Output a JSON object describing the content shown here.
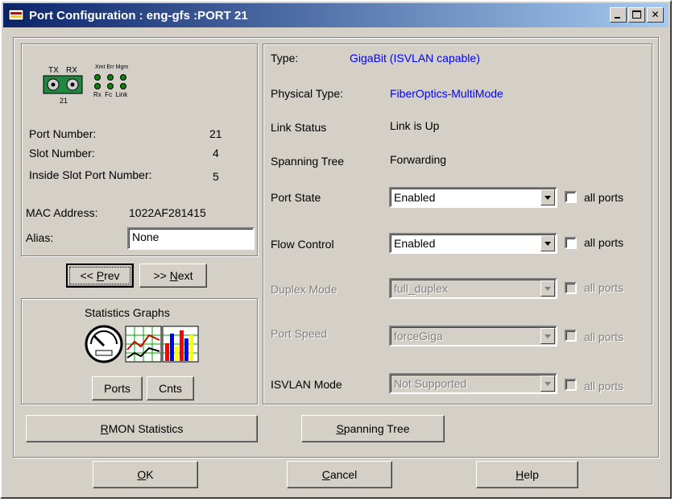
{
  "window": {
    "title": "Port Configuration : eng-gfs :PORT 21"
  },
  "port_icon": {
    "tx": "TX",
    "rx": "RX",
    "top_labels": "Xmt Err Mgm",
    "bottom_labels": "Rx  Fc  Link",
    "number": "21"
  },
  "port_info": {
    "port_number_label": "Port Number:",
    "port_number": "21",
    "slot_number_label": "Slot Number:",
    "slot_number": "4",
    "inside_slot_label": "Inside Slot Port Number:",
    "inside_slot": "5",
    "mac_label": "MAC Address:",
    "mac": "1022AF281415",
    "alias_label": "Alias:",
    "alias_value": "None"
  },
  "nav": {
    "prev_pre": "<< ",
    "prev_key": "P",
    "prev_rest": "rev",
    "next_pre": ">> ",
    "next_key": "N",
    "next_rest": "ext"
  },
  "stats": {
    "title": "Statistics Graphs",
    "ports_label": "Ports",
    "cnts_label": "Cnts"
  },
  "rmon": {
    "key": "R",
    "rest": "MON Statistics"
  },
  "spanning_btn": {
    "key": "S",
    "rest": "panning Tree"
  },
  "details": {
    "type_label": "Type:",
    "type_value": "GigaBit (ISVLAN capable)",
    "phys_label": "Physical Type:",
    "phys_value": "FiberOptics-MultiMode",
    "link_label": "Link Status",
    "link_value": "Link is Up",
    "stp_label": "Spanning Tree",
    "stp_value": "Forwarding",
    "port_state_label": "Port State",
    "port_state_value": "Enabled",
    "flow_label": "Flow Control",
    "flow_value": "Enabled",
    "duplex_label": "Duplex Mode",
    "duplex_value": "full_duplex",
    "speed_label": "Port Speed",
    "speed_value": "forceGiga",
    "isvlan_label": "ISVLAN Mode",
    "isvlan_value": "Not Supported",
    "all_ports": "all ports"
  },
  "footer": {
    "ok_key": "O",
    "ok_rest": "K",
    "cancel_key": "C",
    "cancel_rest": "ancel",
    "help_key": "H",
    "help_rest": "elp"
  },
  "colors": {
    "title_start": "#0a246a",
    "title_end": "#a6caf0",
    "link_blue": "#0000ff",
    "face": "#d4d0c8"
  }
}
